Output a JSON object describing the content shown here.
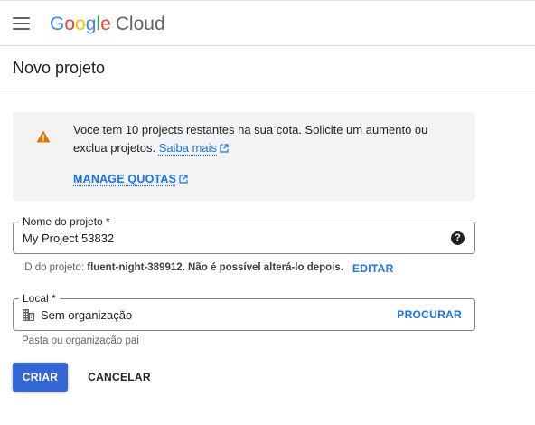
{
  "header": {
    "logo_google": "Google",
    "logo_product": "Cloud",
    "logo_colors": [
      "#4285F4",
      "#EA4335",
      "#FBBC05",
      "#4285F4",
      "#34A853",
      "#EA4335"
    ]
  },
  "page": {
    "title": "Novo projeto"
  },
  "quota_notice": {
    "message": "Voce tem 10 projects restantes na sua cota. Solicite um aumento ou exclua projetos.",
    "learn_more_link": "Saiba mais",
    "manage_quotas_link": "MANAGE QUOTAS",
    "icon": "warning-icon",
    "icon_color": "#e37400"
  },
  "project_name": {
    "label": "Nome do projeto *",
    "value": "My Project 53832",
    "help_icon": "help-icon"
  },
  "project_id": {
    "prefix": "ID do projeto: ",
    "id_text": "fluent-night-389912. Não é possível alterá-lo depois.",
    "edit_label": "EDITAR"
  },
  "location": {
    "label": "Local *",
    "value": "Sem organização",
    "icon": "building-icon",
    "browse_label": "PROCURAR",
    "hint": "Pasta ou organização pai"
  },
  "actions": {
    "create_label": "CRIAR",
    "cancel_label": "CANCELAR"
  },
  "colors": {
    "accent": "#1a73e8",
    "primary_button": "#3367d6",
    "notice_background": "#f1f3f4"
  }
}
